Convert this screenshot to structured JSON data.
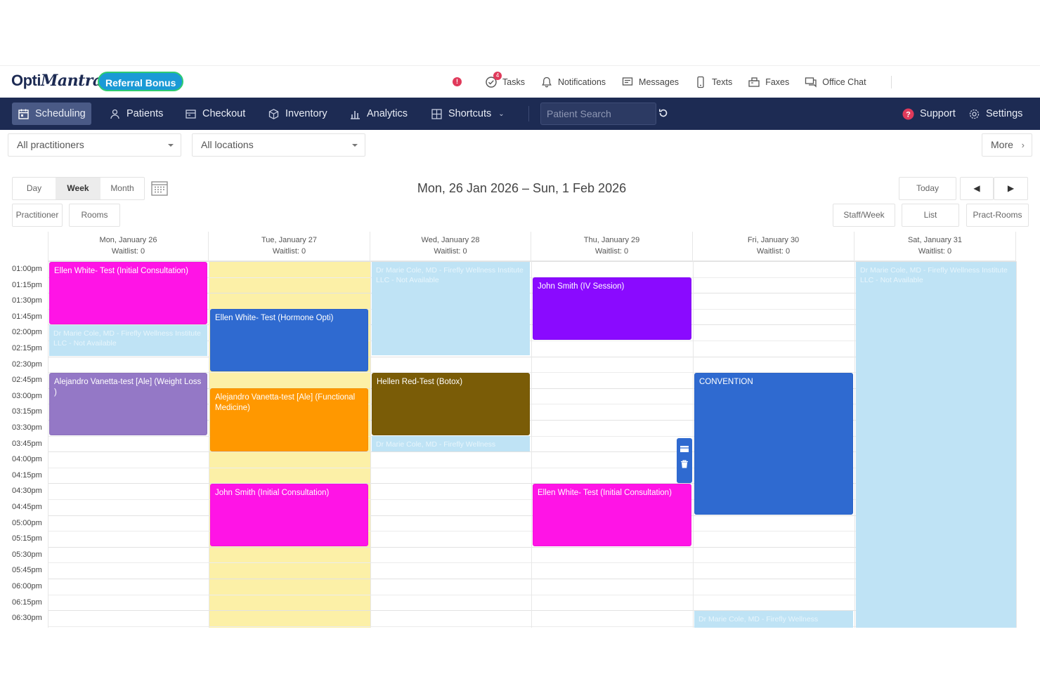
{
  "brand": {
    "logo_a": "Opti",
    "logo_b": "Mantra",
    "referral": "Referral Bonus",
    "alert": "!"
  },
  "topnav": {
    "tasks": "Tasks",
    "tasks_badge": "4",
    "notifications": "Notifications",
    "messages": "Messages",
    "texts": "Texts",
    "faxes": "Faxes",
    "office_chat": "Office Chat"
  },
  "nav": {
    "scheduling": "Scheduling",
    "patients": "Patients",
    "checkout": "Checkout",
    "inventory": "Inventory",
    "analytics": "Analytics",
    "shortcuts": "Shortcuts",
    "patient_search_placeholder": "Patient Search",
    "support": "Support",
    "settings": "Settings"
  },
  "filters": {
    "practitioners": "All practitioners",
    "locations": "All locations",
    "more": "More"
  },
  "view": {
    "day": "Day",
    "week": "Week",
    "month": "Month",
    "practitioner": "Practitioner",
    "rooms": "Rooms",
    "date_range": "Mon, 26 Jan 2026 – Sun, 1 Feb 2026",
    "today": "Today",
    "staff_week": "Staff/Week",
    "list": "List",
    "pract_rooms": "Pract-Rooms"
  },
  "days": [
    {
      "label": "Mon, January 26",
      "waitlist": "Waitlist: 0"
    },
    {
      "label": "Tue, January 27",
      "waitlist": "Waitlist: 0"
    },
    {
      "label": "Wed, January 28",
      "waitlist": "Waitlist: 0"
    },
    {
      "label": "Thu, January 29",
      "waitlist": "Waitlist: 0"
    },
    {
      "label": "Fri, January 30",
      "waitlist": "Waitlist: 0"
    },
    {
      "label": "Sat, January 31",
      "waitlist": "Waitlist: 0"
    }
  ],
  "times": [
    "01:00pm",
    "01:15pm",
    "01:30pm",
    "01:45pm",
    "02:00pm",
    "02:15pm",
    "02:30pm",
    "02:45pm",
    "03:00pm",
    "03:15pm",
    "03:30pm",
    "03:45pm",
    "04:00pm",
    "04:15pm",
    "04:30pm",
    "04:45pm",
    "05:00pm",
    "05:15pm",
    "05:30pm",
    "05:45pm",
    "06:00pm",
    "06:15pm",
    "06:30pm"
  ],
  "events": {
    "mon1": "Ellen White- Test (Initial Consultation)",
    "mon_na": "Dr Marie Cole, MD - Firefly Wellness Institute LLC - Not Available",
    "mon2": "Alejandro Vanetta-test [Ale] (Weight Loss )",
    "tue1": "Ellen White- Test (Hormone Opti)",
    "tue2": "Alejandro Vanetta-test [Ale] (Functional Medicine)",
    "tue3": "John Smith (Initial Consultation)",
    "wed_na1": "Dr Marie Cole, MD - Firefly Wellness Institute LLC - Not Available",
    "wed1": "Hellen Red-Test (Botox)",
    "wed_na2": "Dr Marie Cole, MD - Firefly Wellness",
    "thu1": "John Smith (IV Session)",
    "thu2": "Ellen White- Test (Initial Consultation)",
    "fri1": "CONVENTION",
    "fri_na": "Dr Marie Cole, MD - Firefly Wellness",
    "sat_na": "Dr Marie Cole, MD - Firefly Wellness Institute LLC - Not Available"
  },
  "colors": {
    "magenta": "#ff14e6",
    "blue": "#2f6ad0",
    "purple": "#9478c6",
    "orange": "#ff9800",
    "brown": "#7a5c07",
    "violet": "#8a0aff",
    "unavailable": "#bfe3f5",
    "highlight": "#fcf0a7",
    "nav": "#1d2b53"
  }
}
